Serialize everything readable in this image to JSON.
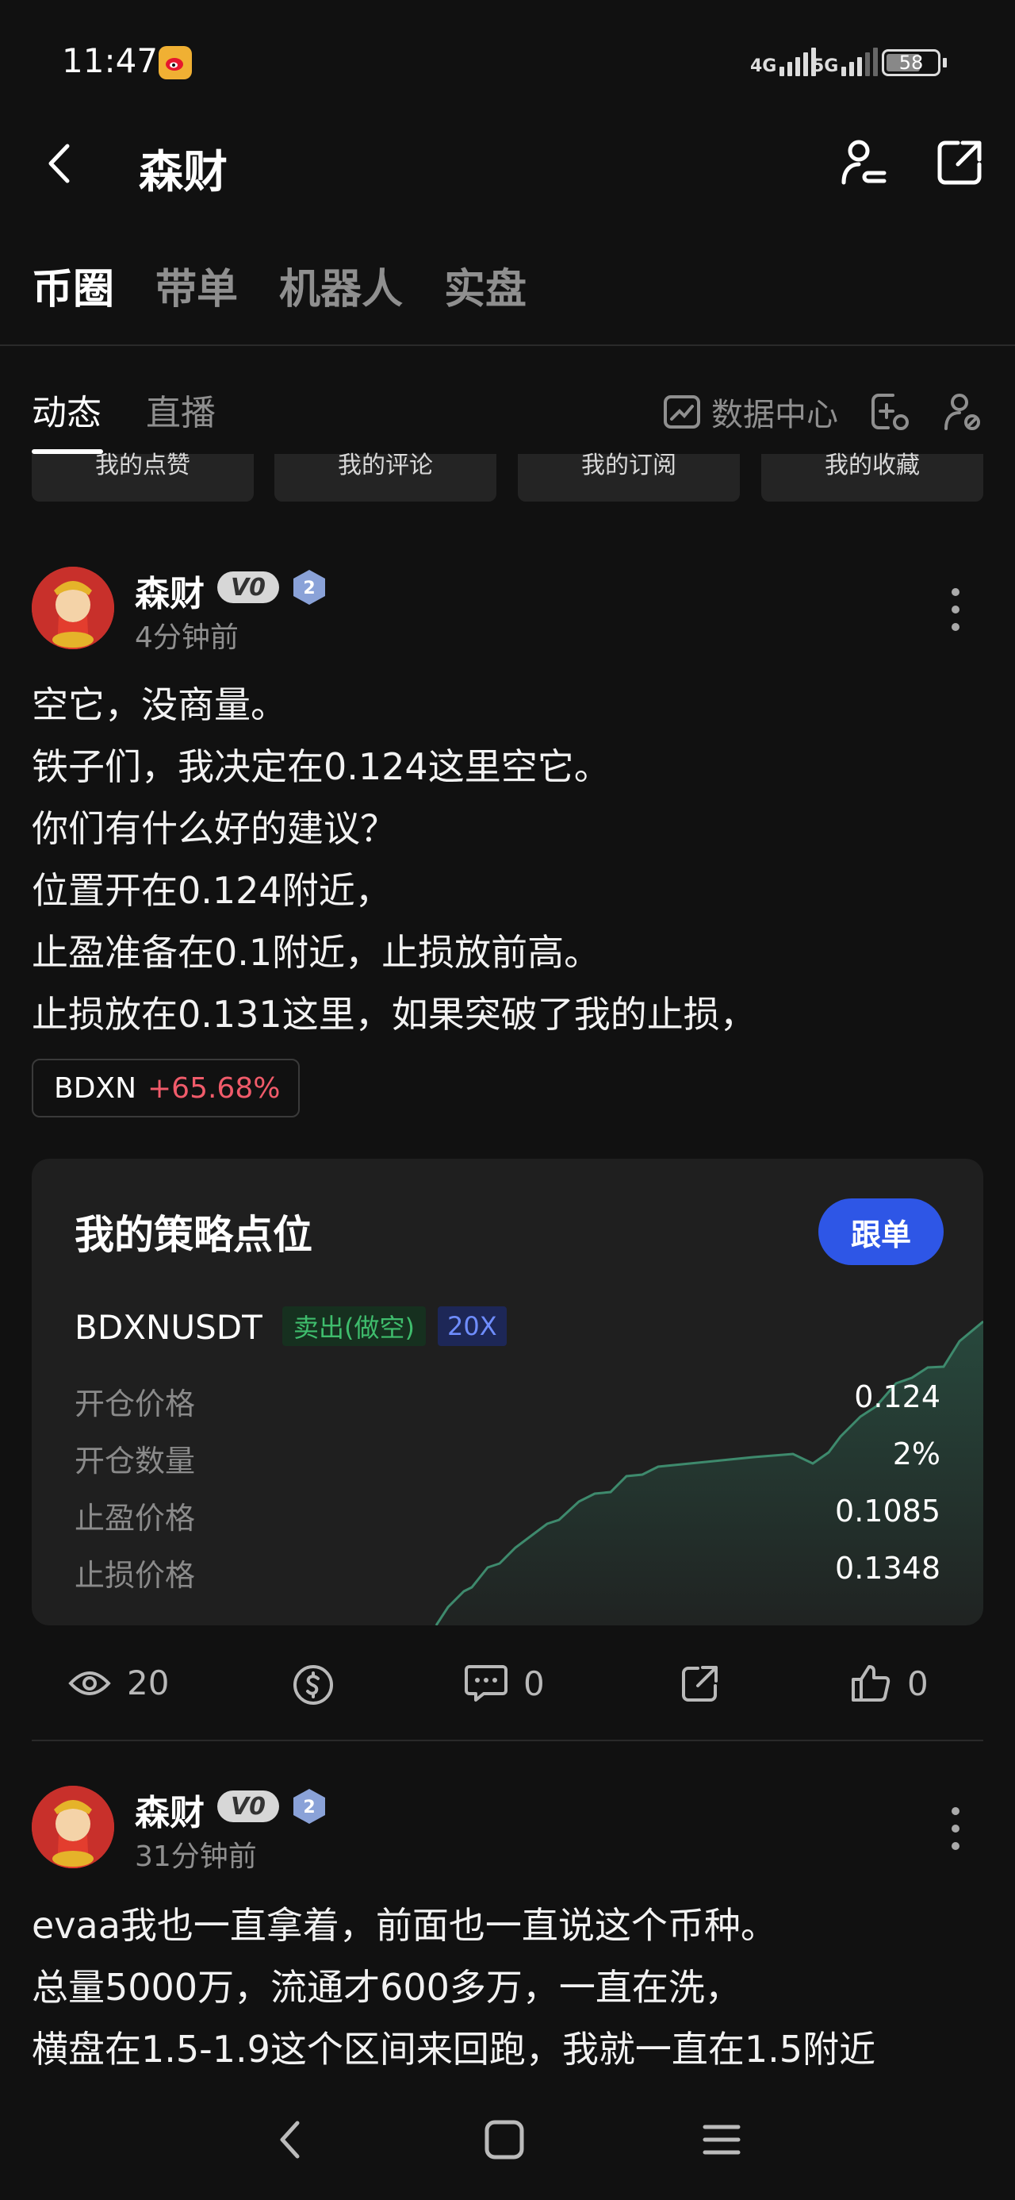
{
  "status_bar": {
    "time": "11:47",
    "net1": "4G",
    "net2": "5G",
    "battery": "58"
  },
  "header": {
    "title": "森财"
  },
  "top_tabs": [
    {
      "label": "币圈"
    },
    {
      "label": "带单"
    },
    {
      "label": "机器人"
    },
    {
      "label": "实盘"
    }
  ],
  "sub_tabs": [
    {
      "label": "动态"
    },
    {
      "label": "直播"
    }
  ],
  "data_center_label": "数据中心",
  "chips": [
    {
      "label": "我的点赞"
    },
    {
      "label": "我的评论"
    },
    {
      "label": "我的订阅"
    },
    {
      "label": "我的收藏"
    }
  ],
  "posts": [
    {
      "username": "森财",
      "vip": "V0",
      "level": "2",
      "time": "4分钟前",
      "lines": [
        "空它，没商量。",
        "铁子们，我决定在0.124这里空它。",
        "你们有什么好的建议？",
        "位置开在0.124附近，",
        "止盈准备在0.1附近，止损放前高。",
        "止损放在0.131这里，如果突破了我的止损，"
      ],
      "tag": {
        "name": "BDXN",
        "change": "+65.68%"
      },
      "strategy": {
        "title": "我的策略点位",
        "follow": "跟单",
        "pair": "BDXNUSDT",
        "side": "卖出(做空)",
        "leverage": "20X",
        "rows": [
          {
            "label": "开仓价格",
            "value": "0.124"
          },
          {
            "label": "开仓数量",
            "value": "2%"
          },
          {
            "label": "止盈价格",
            "value": "0.1085"
          },
          {
            "label": "止损价格",
            "value": "0.1348"
          }
        ]
      },
      "stats": {
        "views": "20",
        "comments": "0",
        "likes": "0"
      }
    },
    {
      "username": "森财",
      "vip": "V0",
      "level": "2",
      "time": "31分钟前",
      "lines": [
        "evaa我也一直拿着，前面也一直说这个币种。",
        "总量5000万，流通才600多万，一直在洗，",
        "横盘在1.5-1.9这个区间来回跑，我就一直在1.5附近"
      ]
    }
  ],
  "colors": {
    "background": "#111111",
    "accent_blue": "#2e56e6",
    "up_red": "#f05b6a",
    "short_green": "#3fbd6d"
  }
}
